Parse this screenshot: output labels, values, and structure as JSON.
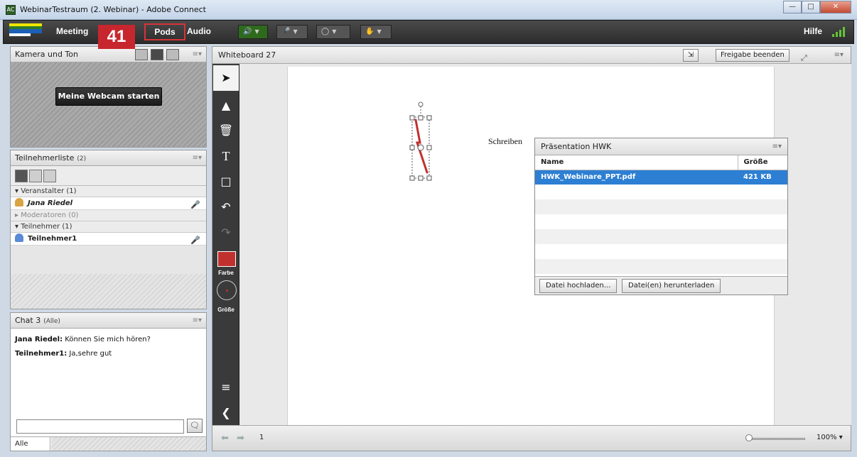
{
  "window": {
    "title": "WebinarTestraum (2. Webinar) - Adobe Connect",
    "icon_text": "AC"
  },
  "menubar": {
    "meeting": "Meeting",
    "pods": "Pods",
    "audio": "Audio",
    "hilfe": "Hilfe",
    "callout_number": "41",
    "speaker_icon": "speaker-icon",
    "mic_icon": "microphone-icon",
    "camera_icon": "webcam-icon",
    "hand_icon": "raise-hand-icon",
    "accent": "#d4343a"
  },
  "camera_pod": {
    "title": "Kamera und Ton",
    "start_button": "Meine Webcam starten"
  },
  "attendee_pod": {
    "title": "Teilnehmerliste",
    "count": "(2)",
    "sections": {
      "hosts": "Veranstalter (1)",
      "moderators": "Moderatoren (0)",
      "participants": "Teilnehmer (1)"
    },
    "hosts": [
      {
        "name": "Jana Riedel"
      }
    ],
    "participants": [
      {
        "name": "Teilnehmer1"
      }
    ]
  },
  "chat_pod": {
    "title": "Chat 3",
    "scope": "(Alle)",
    "messages": [
      {
        "sender": "Jana Riedel:",
        "text": " Können Sie mich hören?"
      },
      {
        "sender": "Teilnehmer1:",
        "text": " Ja,sehre gut"
      }
    ],
    "recipient": "Alle"
  },
  "whiteboard": {
    "title": "Whiteboard 27",
    "stop_share": "Freigabe beenden",
    "tool_labels": {
      "color": "Farbe",
      "size": "Größe"
    },
    "selected_color": "#c0312e",
    "canvas_text": "Schreiben",
    "page": "1",
    "zoom": "100%"
  },
  "presentation": {
    "title": "Präsentation HWK",
    "columns": [
      "Name",
      "Größe"
    ],
    "files": [
      {
        "name": "HWK_Webinare_PPT.pdf",
        "size": "421 KB"
      }
    ],
    "upload": "Datei hochladen...",
    "download": "Datei(en) herunterladen"
  }
}
